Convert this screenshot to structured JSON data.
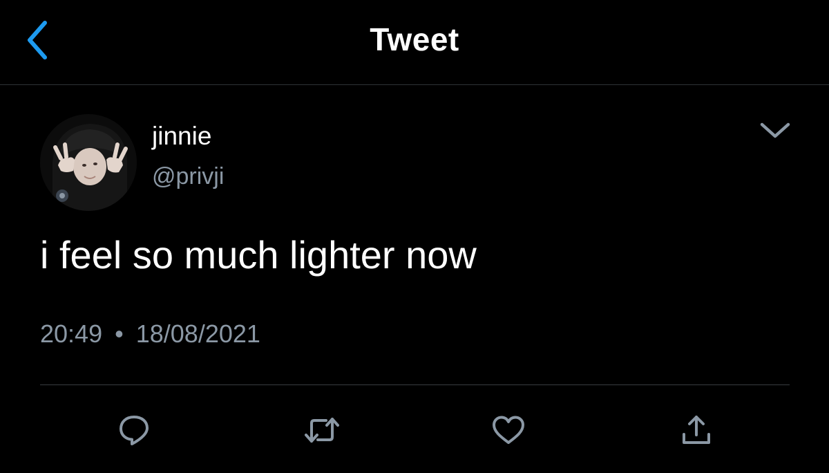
{
  "header": {
    "title": "Tweet",
    "back_icon": "chevron-left-icon"
  },
  "tweet": {
    "author": {
      "display_name": "jinnie",
      "handle": "@privji"
    },
    "text": "i feel so much lighter now",
    "time": "20:49",
    "separator": "•",
    "date": "18/08/2021",
    "more_icon": "chevron-down-icon"
  },
  "actions": [
    {
      "name": "reply",
      "icon": "reply-icon"
    },
    {
      "name": "retweet",
      "icon": "retweet-icon"
    },
    {
      "name": "like",
      "icon": "heart-icon"
    },
    {
      "name": "share",
      "icon": "share-icon"
    }
  ],
  "colors": {
    "background": "#000000",
    "text": "#ffffff",
    "secondary_text": "#8b98a5",
    "accent": "#1d9bf0",
    "divider": "#2f3336"
  }
}
